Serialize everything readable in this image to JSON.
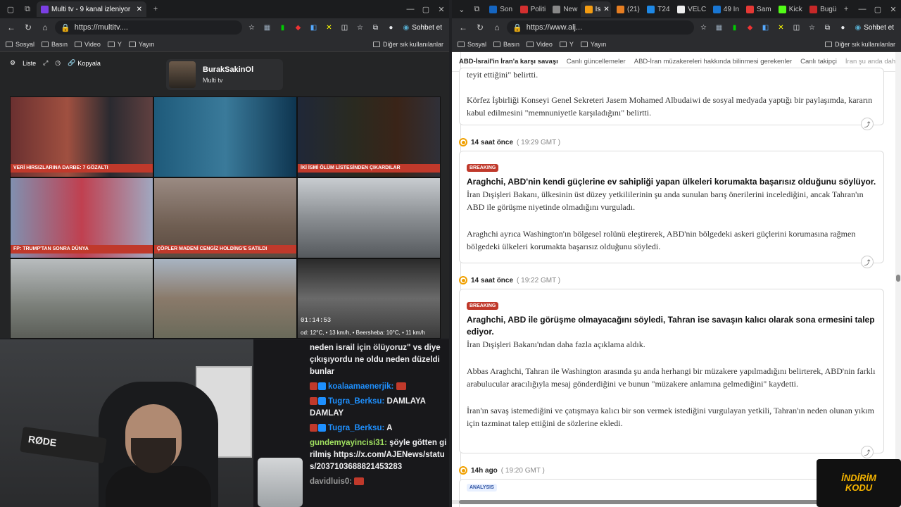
{
  "left": {
    "tabs": [
      {
        "title": "Multi tv - 9 kanal izleniyor"
      }
    ],
    "url": "https://multitv....",
    "copilot": "Sohbet et",
    "bookmarks": [
      "Sosyal",
      "Basın",
      "Video",
      "Y",
      "Yayın"
    ],
    "bookmarks_right": "Diğer sık kullanılanlar",
    "toolbar": {
      "list": "Liste",
      "copy": "Kopyala"
    },
    "profile": {
      "name": "BurakSakinOl",
      "sub": "Multi tv"
    },
    "tiles": [
      {
        "strip": "VERİ HIRSIZLARINA DARBE: 7 GÖZALTI",
        "color": "#c0392b"
      },
      {
        "strip": "",
        "color": ""
      },
      {
        "strip": "İKİ İSMİ ÖLÜM LİSTESİNDEN ÇIKARDILAR",
        "color": "#c0392b"
      },
      {
        "strip": "FP: TRUMP'TAN SONRA DÜNYA",
        "color": "#c0392b"
      },
      {
        "strip": "ÇÖPLER MADENİ CENGİZ HOLDİNG'E SATILDI",
        "color": "#c0392b"
      },
      {
        "strip": "",
        "color": ""
      },
      {
        "strip": "",
        "color": ""
      },
      {
        "strip": "",
        "color": ""
      },
      {
        "strip": "od: 12°C, • 13 km/h, • Beersheba: 10°C, • 11 km/h",
        "color": ""
      }
    ],
    "clock": "01:14:53"
  },
  "chat": [
    {
      "user": "",
      "text": "neden israil için ölüyoruz\" vs diye çıkışıyordu ne oldu neden düzeldi bunlar"
    },
    {
      "user": "koalaamaenerjik:",
      "text": ""
    },
    {
      "user": "Tugra_Berksu:",
      "text": "DAMLAYA DAMLAY"
    },
    {
      "user": "Tugra_Berksu:",
      "text": "A"
    },
    {
      "user": "gundemyayincisi31:",
      "text": "şöyle götten girilmiş https://x.com/AJENews/status/2037103688821453283"
    },
    {
      "user": "davidluis0:",
      "text": ""
    }
  ],
  "right": {
    "tabs": [
      "Son",
      "Politi",
      "New",
      "Is",
      "(21)",
      "T24",
      "VELC",
      "49 In",
      "Sam",
      "Kick",
      "Bugü"
    ],
    "url": "https://www.alj...",
    "copilot": "Sohbet et",
    "bookmarks": [
      "Sosyal",
      "Basın",
      "Video",
      "Y",
      "Yayın"
    ],
    "bookmarks_right": "Diğer sık kullanılanlar",
    "nav": [
      "ABD-İsrail'in İran'a karşı savaşı",
      "Canlı güncellemeler",
      "ABD-İran müzakereleri hakkında bilinmesi gerekenler",
      "Canlı takipçi",
      "İran şu anda dah"
    ],
    "card0": {
      "top": "teyit ettiğini\" belirtti.",
      "p": "Körfez İşbirliği Konseyi Genel Sekreteri Jasem Mohamed Albudaiwi de sosyal medyada yaptığı bir paylaşımda, kararın kabul edilmesini \"memnuniyetle karşıladığını\" belirtti."
    },
    "posts": [
      {
        "time": "14 saat önce",
        "gmt": "( 19:29 GMT )",
        "tag": "BREAKING",
        "headline": "Araghchi, ABD'nin kendi güçlerine ev sahipliği yapan ülkeleri korumakta başarısız olduğunu söylüyor.",
        "p1": "İran Dışişleri Bakanı, ülkesinin üst düzey yetkililerinin şu anda sunulan barış önerilerini incelediğini, ancak Tahran'ın ABD ile görüşme niyetinde olmadığını vurguladı.",
        "p2": "Araghchi ayrıca Washington'ın bölgesel rolünü eleştirerek, ABD'nin bölgedeki askeri güçlerini korumasına rağmen bölgedeki ülkeleri korumakta başarısız olduğunu söyledi.",
        "p3": ""
      },
      {
        "time": "14 saat önce",
        "gmt": "( 19:22 GMT )",
        "tag": "BREAKING",
        "headline": "Araghchi, ABD ile görüşme olmayacağını söyledi, Tahran ise savaşın kalıcı olarak sona ermesini talep ediyor.",
        "p1": "İran Dışişleri Bakanı'ndan daha fazla açıklama aldık.",
        "p2": "Abbas Araghchi, Tahran ile Washington arasında şu anda herhangi bir müzakere yapılmadığını belirterek, ABD'nin farklı arabulucular aracılığıyla mesaj gönderdiğini ve bunun \"müzakere anlamına gelmediğini\" kaydetti.",
        "p3": "İran'ın savaş istemediğini ve çatışmaya kalıcı bir son vermek istediğini vurgulayan yetkili, Tahran'ın neden olunan yıkım için tazminat talep ettiğini de sözlerine ekledi."
      }
    ],
    "last_time": "14h ago",
    "last_gmt": "( 19:20 GMT )",
    "analysis": "ANALYSIS"
  },
  "promo": {
    "line1": "İNDİRİM",
    "line2": "KODU"
  },
  "cam": {
    "mic_brand": "RØDE"
  }
}
